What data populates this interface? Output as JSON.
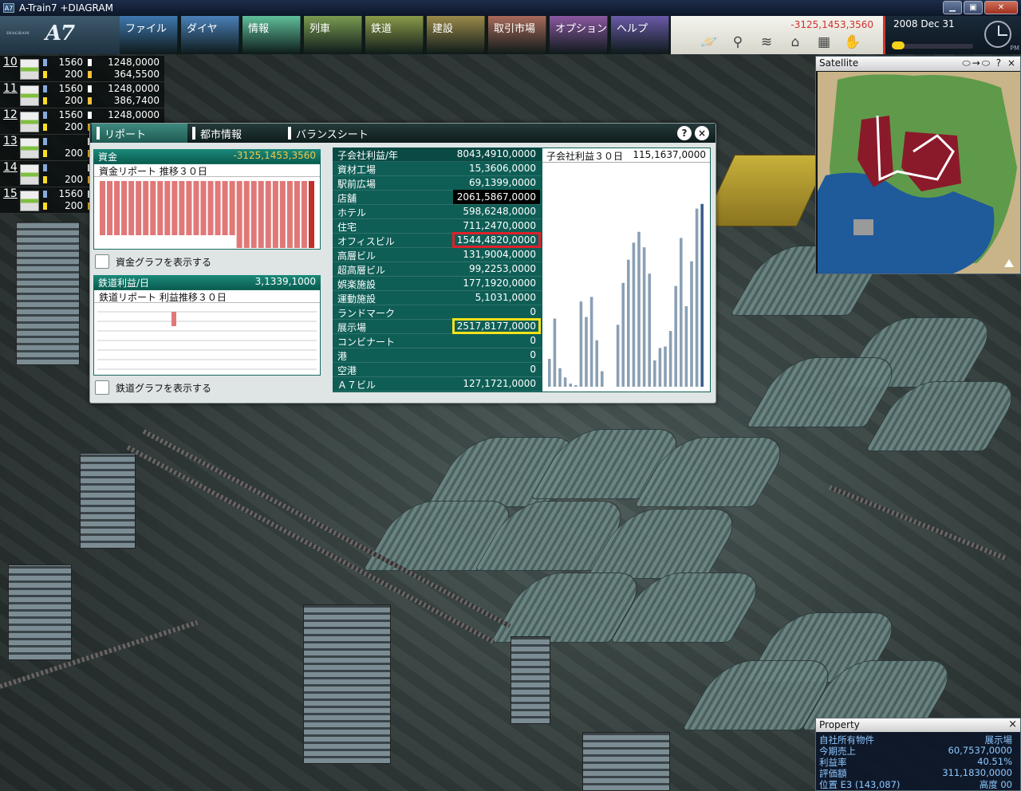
{
  "window": {
    "title": "A-Train7 +DIAGRAM",
    "icon_label": "A7"
  },
  "logo": {
    "text": "A7",
    "sub": "DIAGRAM"
  },
  "menu": [
    {
      "label": "ファイル",
      "color": "#3f78b0"
    },
    {
      "label": "ダイヤ",
      "color": "#4a80b8"
    },
    {
      "label": "情報",
      "color": "#5fbf9a"
    },
    {
      "label": "列車",
      "color": "#7a9a50"
    },
    {
      "label": "鉄道",
      "color": "#8a9a48"
    },
    {
      "label": "建設",
      "color": "#9a8a4a"
    },
    {
      "label": "取引市場",
      "color": "#a86a5a"
    },
    {
      "label": "オプション",
      "color": "#8a58a0"
    },
    {
      "label": "ヘルプ",
      "color": "#6a5aa8"
    }
  ],
  "toolbar": {
    "money": "-3125,1453,3560",
    "icons": [
      "planet-icon",
      "magnifier-icon",
      "layers-icon",
      "building-icon",
      "grid-icon",
      "hand-icon"
    ]
  },
  "datetime": {
    "date": "2008 Dec 31",
    "ampm": "PM"
  },
  "trains": [
    {
      "num": "10",
      "a1": "1560",
      "b1": "1248,0000",
      "a2": "200",
      "b2": "364,5500"
    },
    {
      "num": "11",
      "a1": "1560",
      "b1": "1248,0000",
      "a2": "200",
      "b2": "386,7400"
    },
    {
      "num": "12",
      "a1": "1560",
      "b1": "1248,0000",
      "a2": "200",
      "b2": ""
    },
    {
      "num": "13",
      "a1": "",
      "b1": "",
      "a2": "200",
      "b2": ""
    },
    {
      "num": "14",
      "a1": "",
      "b1": "",
      "a2": "200",
      "b2": ""
    },
    {
      "num": "15",
      "a1": "1560",
      "b1": "",
      "a2": "200",
      "b2": ""
    }
  ],
  "report": {
    "tabs": [
      "リポート",
      "都市情報",
      "バランスシート"
    ],
    "help_label": "?",
    "close_label": "×",
    "funds": {
      "label": "資金",
      "value": "-3125,1453,3560",
      "subtitle": "資金リポート 推移３０日",
      "bars": [
        1,
        1,
        1,
        1,
        1,
        1,
        1,
        1,
        1,
        1,
        1,
        1,
        1,
        1,
        1,
        1,
        1,
        1,
        1,
        1,
        1,
        1,
        1,
        1,
        1,
        1,
        1,
        1,
        1,
        1
      ],
      "dips": [
        0,
        0,
        0,
        0,
        0,
        0,
        0,
        0,
        0,
        0,
        0,
        0,
        0,
        0,
        0,
        0,
        0,
        0,
        0,
        1,
        1,
        1,
        1,
        1,
        1,
        1,
        1,
        1,
        1,
        1
      ],
      "checkbox_label": "資金グラフを表示する"
    },
    "rail": {
      "label": "鉄道利益/日",
      "value": "3,1339,1000",
      "subtitle": "鉄道リポート 利益推移３０日",
      "checkbox_label": "鉄道グラフを表示する"
    },
    "subsidiary": {
      "header_label": "子会社利益/年",
      "header_value": "8043,4910,0000",
      "rows": [
        {
          "label": "資材工場",
          "value": "15,3606,0000",
          "hl": ""
        },
        {
          "label": "駅前広場",
          "value": "69,1399,0000",
          "hl": ""
        },
        {
          "label": "店舗",
          "value": "2061,5867,0000",
          "hl": "black"
        },
        {
          "label": "ホテル",
          "value": "598,6248,0000",
          "hl": ""
        },
        {
          "label": "住宅",
          "value": "711,2470,0000",
          "hl": ""
        },
        {
          "label": "オフィスビル",
          "value": "1544,4820,0000",
          "hl": "red"
        },
        {
          "label": "高層ビル",
          "value": "131,9004,0000",
          "hl": ""
        },
        {
          "label": "超高層ビル",
          "value": "99,2253,0000",
          "hl": ""
        },
        {
          "label": "娯楽施設",
          "value": "177,1920,0000",
          "hl": ""
        },
        {
          "label": "運動施設",
          "value": "5,1031,0000",
          "hl": ""
        },
        {
          "label": "ランドマーク",
          "value": "0",
          "hl": ""
        },
        {
          "label": "展示場",
          "value": "2517,8177,0000",
          "hl": "yellow"
        },
        {
          "label": "コンビナート",
          "value": "0",
          "hl": ""
        },
        {
          "label": "港",
          "value": "0",
          "hl": ""
        },
        {
          "label": "空港",
          "value": "0",
          "hl": ""
        },
        {
          "label": "Ａ７ビル",
          "value": "127,1721,0000",
          "hl": ""
        }
      ]
    },
    "subsidiary_chart": {
      "title": "子会社利益３０日",
      "value": "115,1637,0000"
    }
  },
  "chart_data": [
    {
      "type": "bar",
      "title": "子会社利益３０日",
      "values": [
        18,
        44,
        12,
        6,
        2,
        1,
        55,
        45,
        58,
        30,
        10,
        0,
        0,
        40,
        67,
        82,
        93,
        100,
        90,
        73,
        17,
        25,
        26,
        36,
        65,
        96,
        52,
        81,
        115,
        118
      ],
      "ylim": [
        0,
        140
      ]
    }
  ],
  "satellite": {
    "title": "Satellite",
    "controls": "⬭→⬭  ?  ×"
  },
  "property": {
    "title": "Property",
    "close_label": "×",
    "rows": [
      {
        "label": "自社所有物件",
        "value": "展示場"
      },
      {
        "label": "今期売上",
        "value": "60,7537,0000"
      },
      {
        "label": "利益率",
        "value": "40.51%"
      },
      {
        "label": "評価額",
        "value": "311,1830,0000"
      },
      {
        "label": "位置 E3 (143,087)",
        "value": "高度 00"
      }
    ]
  },
  "colors": {
    "accent": "#0f5e56",
    "money_negative": "#d0302a",
    "funds_bar": "#e07878"
  }
}
